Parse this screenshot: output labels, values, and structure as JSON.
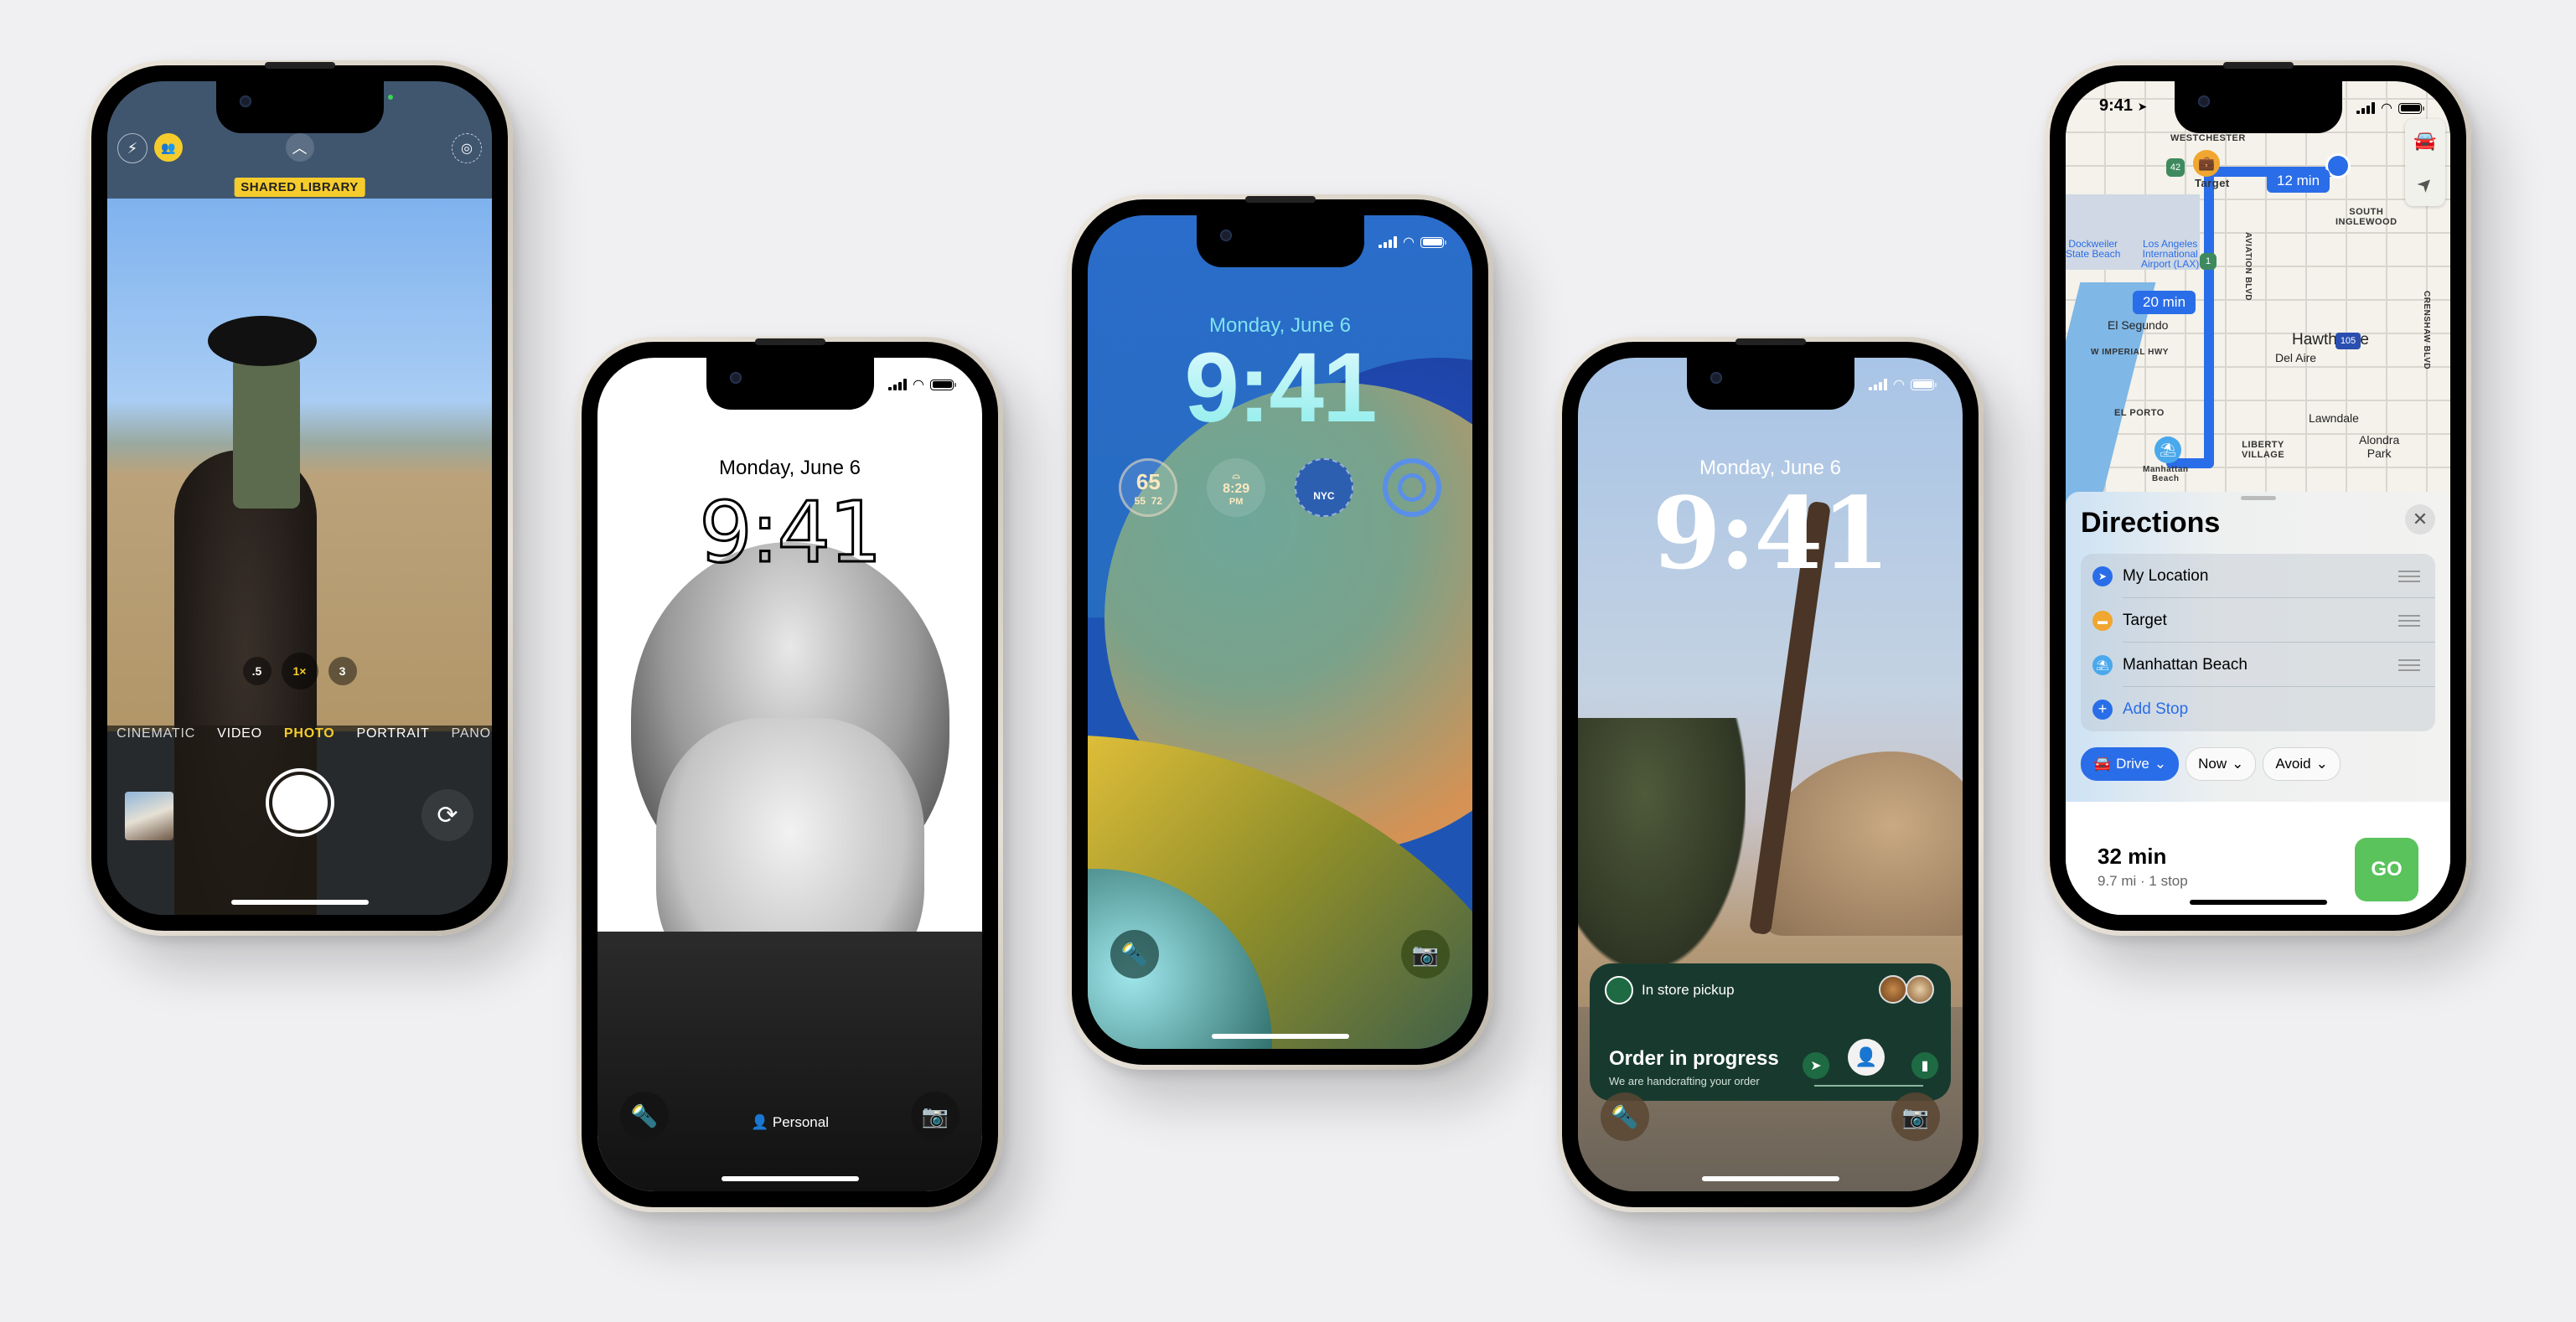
{
  "page": {
    "background": "#f0f0f2"
  },
  "phones": {
    "camera": {
      "top_icons": {
        "flash": "flash-icon",
        "shared": "shared-library-icon",
        "chevron": "chevron-up-icon",
        "live": "live-photo-icon"
      },
      "shared_library_label": "SHARED LIBRARY",
      "zoom_options": [
        ".5",
        "1×",
        "3"
      ],
      "zoom_selected": "1×",
      "modes": [
        "CINEMATIC",
        "VIDEO",
        "PHOTO",
        "PORTRAIT",
        "PANO"
      ],
      "mode_selected": "PHOTO",
      "accent": "#f5cc2b"
    },
    "bw_lock": {
      "date": "Monday, June 6",
      "time": "9:41",
      "focus_label": "Personal",
      "flashlight_icon": "flashlight-icon",
      "camera_icon": "camera-icon"
    },
    "color_lock": {
      "date": "Monday, June 6",
      "time": "9:41",
      "widgets": {
        "weather": {
          "current": "65",
          "low": "55",
          "high": "72"
        },
        "sunset": {
          "time": "8:29",
          "period": "PM"
        },
        "clock": {
          "city": "NYC"
        },
        "activity": {
          "icon": "activity-rings-icon"
        }
      }
    },
    "photo_lock": {
      "date": "Monday, June 6",
      "time": "9:41",
      "live_activity": {
        "source": "In store pickup",
        "title": "Order in progress",
        "subtitle": "We are handcrafting your order",
        "stages": [
          "sent",
          "preparing",
          "ready"
        ],
        "current_stage": "preparing",
        "brand_color": "#1e6b43"
      }
    },
    "maps": {
      "status_time": "9:41",
      "map_labels": {
        "westchester": "WESTCHESTER",
        "target": "Target",
        "south_inglewood": "SOUTH\nINGLEWOOD",
        "dockweiler": "Dockweiler\nState Beach",
        "lax": "Los Angeles\nInternational\nAirport (LAX)",
        "imperial": "W IMPERIAL HWY",
        "el_segundo": "El Segundo",
        "hawthorne": "Hawthorne",
        "del_aire": "Del Aire",
        "el_porto": "EL PORTO",
        "lawndale": "Lawndale",
        "liberty": "LIBERTY\nVILLAGE",
        "alondra": "Alondra\nPark",
        "manhattan": "Manhattan\nBeach",
        "aviation": "AVIATION BLVD",
        "crenshaw": "CRENSHAW BLVD",
        "hwy42": "42",
        "hwy1": "1",
        "i105": "105"
      },
      "eta_bubbles": [
        "12 min",
        "20 min"
      ],
      "sheet": {
        "title": "Directions",
        "stops": [
          {
            "label": "My Location",
            "icon": "location-arrow-icon",
            "color": "#2a6de8"
          },
          {
            "label": "Target",
            "icon": "shopping-bag-icon",
            "color": "#f0a630"
          },
          {
            "label": "Manhattan Beach",
            "icon": "beach-umbrella-icon",
            "color": "#4aa8ec"
          }
        ],
        "add_stop": "Add Stop",
        "chips": [
          {
            "label": "Drive",
            "primary": true
          },
          {
            "label": "Now",
            "primary": false
          },
          {
            "label": "Avoid",
            "primary": false
          }
        ],
        "route_time": "32 min",
        "route_detail": "9.7 mi · 1 stop",
        "go_label": "GO",
        "go_color": "#5ac35c"
      }
    }
  }
}
